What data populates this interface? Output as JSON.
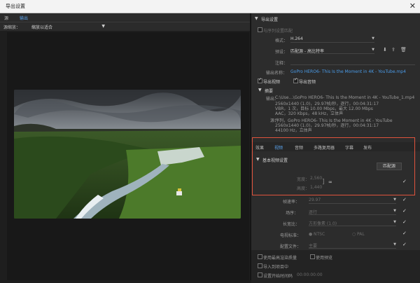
{
  "window": {
    "title": "导出设置"
  },
  "left_tabs": [
    "源",
    "输出"
  ],
  "source": {
    "label": "源缩放：",
    "value": "缩放以适合"
  },
  "export_settings": {
    "header": "导出设置",
    "match_sequence": "与序列设置匹配",
    "format_label": "格式：",
    "format_value": "H.264",
    "preset_label": "预设：",
    "preset_value": "匹配源 - 高比特率",
    "comment_label": "注释：",
    "output_name_label": "输出名称：",
    "output_name_value": "GoPro HERO6- This Is the Moment in 4K - YouTube.mp4",
    "export_video": "导出视频",
    "export_audio": "导出音频",
    "summary_header": "摘要",
    "output_label": "输出：",
    "output_lines": [
      "C:\\Use…\\GoPro HERO6- This Is the Moment in 4K - YouTube_1.mp4",
      "2560x1440 (1.0)，29.97帧/秒，逐行，00:04:31:17",
      "VBR，1 次，目标 10.00 Mbps，最大 12.00 Mbps",
      "AAC，320 Kbps，48 kHz，立体声"
    ],
    "source_label": "源：",
    "source_lines": [
      "序列，GoPro HERO6- This Is the Moment in 4K - YouTube",
      "2560x1440 (1.0)，29.97帧/秒，逐行，00:04:31:17",
      "44100 Hz，立体声"
    ]
  },
  "tabs": [
    "效果",
    "视频",
    "音频",
    "多路复用器",
    "字幕",
    "发布"
  ],
  "active_tab": "视频",
  "basic_video": {
    "header": "基本视频设置",
    "match_source_button": "匹配源",
    "width_label": "宽度：",
    "width_value": "2,560",
    "height_label": "高度：",
    "height_value": "1,440"
  },
  "more_settings": [
    {
      "label": "帧速率：",
      "value": "29.97"
    },
    {
      "label": "场序：",
      "value": "逐行"
    },
    {
      "label": "长宽比：",
      "value": "方形像素 (1.0)"
    },
    {
      "label": "电视标准：",
      "value": "NTSC",
      "alt": "PAL"
    },
    {
      "label": "配置文件：",
      "value": "主要"
    }
  ],
  "bottom_options": [
    "使用最高渲染质量",
    "使用预览",
    "导入到项目中",
    "设置开始时间码",
    "00:00:00:00"
  ],
  "colors": {
    "highlight": "#e0533c",
    "accent": "#4a9be8"
  },
  "icons": [
    "close-icon",
    "dropdown-caret-icon",
    "save-preset-icon",
    "import-preset-icon",
    "delete-preset-icon",
    "link-icon",
    "collapse-triangle-icon"
  ]
}
